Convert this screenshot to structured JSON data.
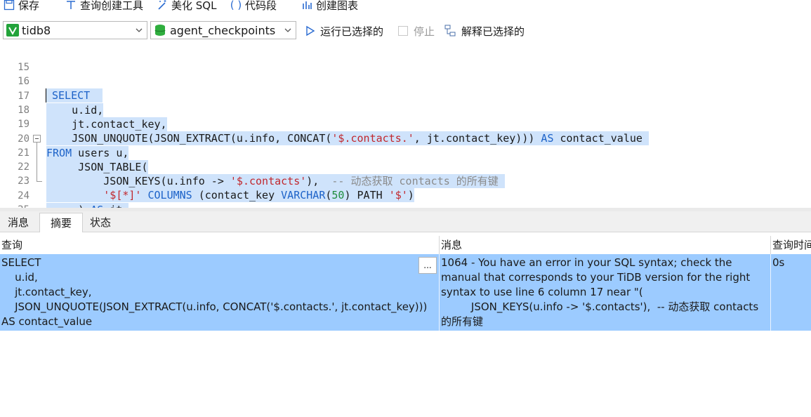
{
  "toolbar": {
    "save": "保存",
    "query_builder": "查询创建工具",
    "beautify": "美化 SQL",
    "snippet": "代码段",
    "create_chart": "创建图表"
  },
  "connection": {
    "server": "tidb8",
    "database": "agent_checkpoints",
    "run_selected": "运行已选择的",
    "stop": "停止",
    "explain_selected": "解释已选择的"
  },
  "editor": {
    "lines": [
      {
        "n": "15",
        "text": ""
      },
      {
        "n": "16",
        "text": "SELECT"
      },
      {
        "n": "17",
        "text": "    u.id,"
      },
      {
        "n": "18",
        "text": "    jt.contact_key,"
      },
      {
        "n": "19",
        "text": "    JSON_UNQUOTE(JSON_EXTRACT(u.info, CONCAT('$.contacts.', jt.contact_key))) AS contact_value"
      },
      {
        "n": "20",
        "text": "FROM users u,"
      },
      {
        "n": "21",
        "text": "     JSON_TABLE("
      },
      {
        "n": "22",
        "text": "         JSON_KEYS(u.info -> '$.contacts'),  -- 动态获取 contacts 的所有键"
      },
      {
        "n": "23",
        "text": "         '$[*]' COLUMNS (contact_key VARCHAR(50) PATH '$')"
      },
      {
        "n": "24",
        "text": "     ) AS jt;"
      },
      {
        "n": "25",
        "text": ""
      }
    ]
  },
  "tabs": [
    "消息",
    "摘要",
    "状态"
  ],
  "results": {
    "headers": [
      "查询",
      "消息",
      "查询时间"
    ],
    "row": {
      "query": "SELECT\n    u.id,\n    jt.contact_key,\n    JSON_UNQUOTE(JSON_EXTRACT(u.info, CONCAT('$.contacts.', jt.contact_key)))\nAS contact_value",
      "message": "1064 - You have an error in your SQL syntax; check the\nmanual that corresponds to your TiDB version for the right\nsyntax to use line 6 column 17 near \"(\n         JSON_KEYS(u.info -> '$.contacts'),  -- 动态获取 contacts\n的所有键",
      "time": "0s",
      "ellipsis": "..."
    }
  },
  "colors": {
    "selection": "#cfe3fb",
    "row_selected": "#9ccbff",
    "keyword": "#1c62c8",
    "string": "#c1272d",
    "number": "#1e8c3c"
  }
}
